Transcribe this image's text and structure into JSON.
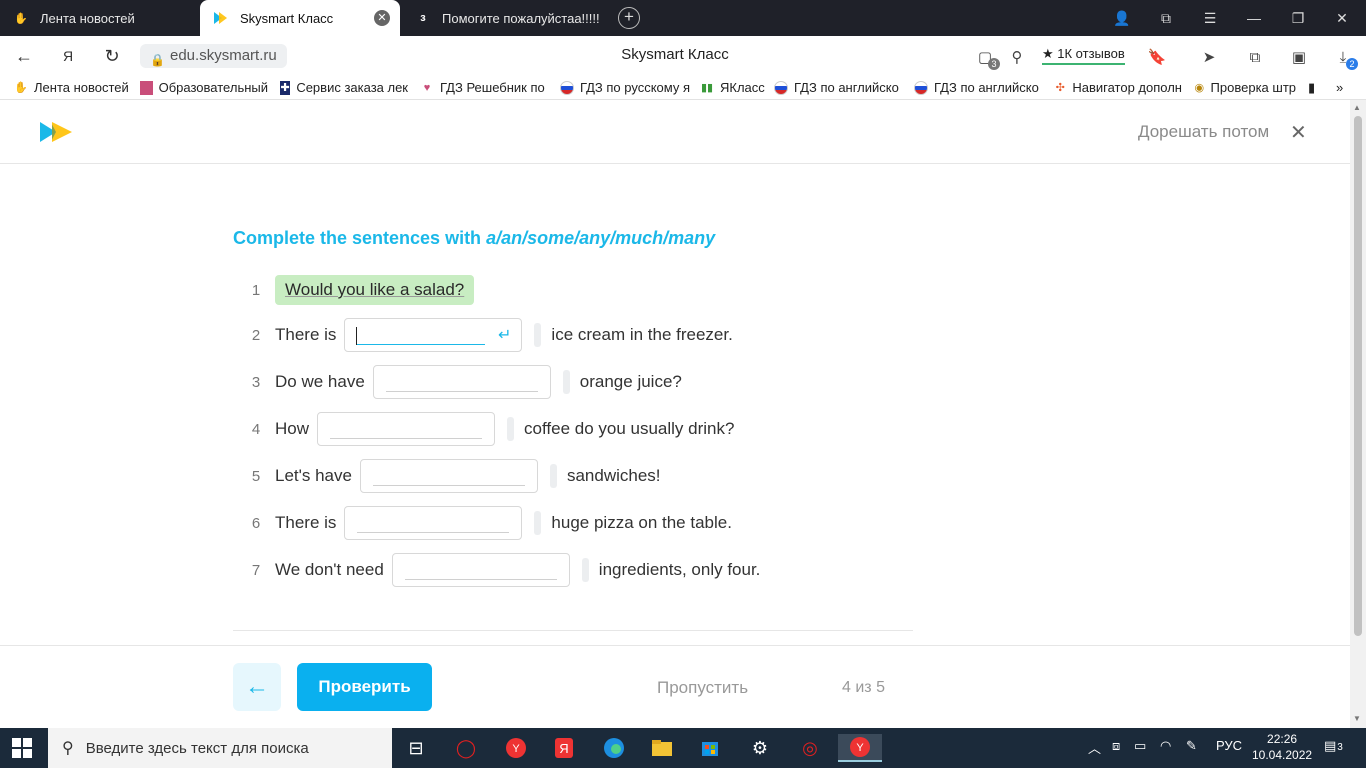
{
  "browser": {
    "tabs": [
      {
        "label": "Лента новостей",
        "active": false
      },
      {
        "label": "Skysmart Класс",
        "active": true
      },
      {
        "label": "Помогите пожалуйстаа!!!!!",
        "active": false
      }
    ],
    "url": "edu.skysmart.ru",
    "page_title": "Skysmart Класс",
    "reviews_label": "★ 1К отзывов",
    "badge_tabs": "3",
    "badge_downloads": "2",
    "bookmarks": [
      {
        "label": "Лента новостей"
      },
      {
        "label": "Образовательный"
      },
      {
        "label": "Сервис заказа лек"
      },
      {
        "label": "ГДЗ Решебник по"
      },
      {
        "label": "ГДЗ по русскому я"
      },
      {
        "label": "ЯКласс"
      },
      {
        "label": "ГДЗ по английско"
      },
      {
        "label": "ГДЗ по английско"
      },
      {
        "label": "Навигатор дополн"
      },
      {
        "label": "Проверка штр"
      }
    ]
  },
  "header": {
    "later_label": "Дорешать потом",
    "close_symbol": "✕"
  },
  "task": {
    "title_prefix": "Complete the sentences with ",
    "title_emphasis": "a/an/some/any/much/many",
    "items": [
      {
        "num": "1",
        "answered": "Would you like a salad?"
      },
      {
        "num": "2",
        "before": "There is",
        "after": "ice cream in the freezer."
      },
      {
        "num": "3",
        "before": "Do we have",
        "after": "orange juice?"
      },
      {
        "num": "4",
        "before": "How",
        "after": "coffee do you usually drink?"
      },
      {
        "num": "5",
        "before": "Let's have",
        "after": "sandwiches!"
      },
      {
        "num": "6",
        "before": "There is",
        "after": "huge pizza on the table."
      },
      {
        "num": "7",
        "before": "We don't need",
        "after": "ingredients, only four."
      }
    ]
  },
  "footer": {
    "back_symbol": "←",
    "check_label": "Проверить",
    "skip_label": "Пропустить",
    "progress_label": "4 из 5"
  },
  "taskbar": {
    "search_placeholder": "Введите здесь текст для поиска",
    "lang": "РУС",
    "time": "22:26",
    "date": "10.04.2022",
    "notif_count": "3"
  },
  "colors": {
    "accent": "#1bb8e8",
    "button": "#0ab0ef",
    "answered_bg": "#c8edc2"
  }
}
